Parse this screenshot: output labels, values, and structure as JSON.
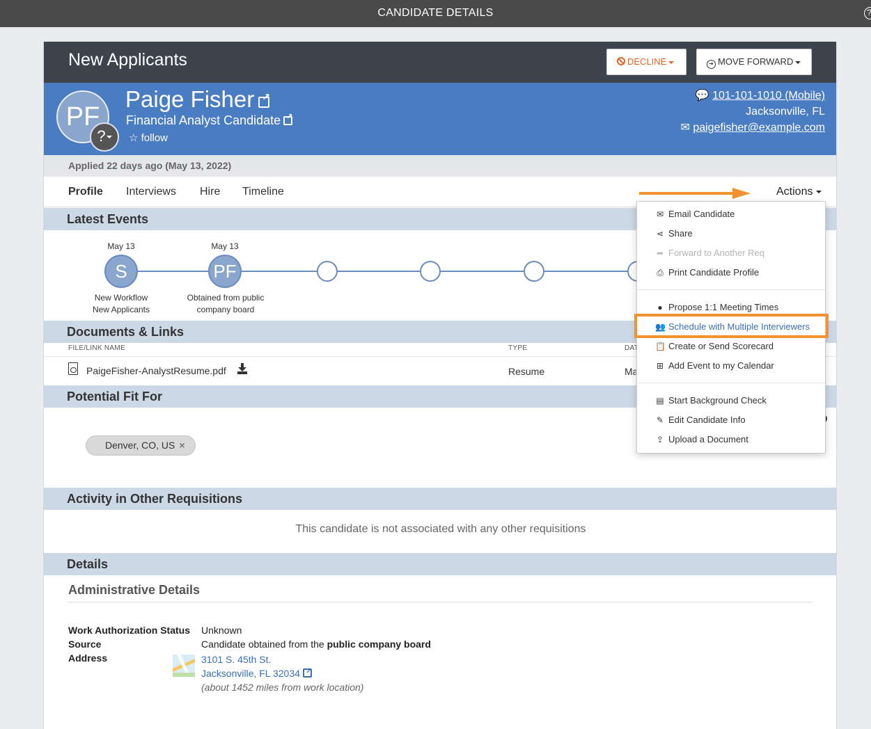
{
  "window": {
    "title": "CANDIDATE DETAILS",
    "help": "?"
  },
  "header": {
    "title": "New Applicants",
    "decline_label": "DECLINE",
    "forward_label": "MOVE FORWARD"
  },
  "candidate": {
    "initials": "PF",
    "name": "Paige Fisher",
    "role": "Financial Analyst Candidate",
    "follow_label": "follow",
    "phone": "101-101-1010 (Mobile)",
    "location": "Jacksonville, FL",
    "email": "paigefisher@example.com",
    "applied": "Applied 22 days ago (May 13, 2022)"
  },
  "tabs": [
    {
      "label": "Profile"
    },
    {
      "label": "Interviews"
    },
    {
      "label": "Hire"
    },
    {
      "label": "Timeline"
    }
  ],
  "actions_label": "Actions",
  "sections": {
    "latest_events": "Latest Events",
    "documents": "Documents & Links",
    "potential_fit": "Potential Fit For",
    "other_reqs": "Activity in Other Requisitions",
    "details": "Details"
  },
  "events": [
    {
      "date": "May 13",
      "initials": "S",
      "label1": "New Workflow",
      "label2": "New Applicants"
    },
    {
      "date": "May 13",
      "initials": "PF",
      "label1": "Obtained from public",
      "label2": "company board"
    }
  ],
  "documents": {
    "headers": {
      "name": "FILE/LINK NAME",
      "type": "TYPE",
      "date": "DAT"
    },
    "rows": [
      {
        "name": "PaigeFisher-AnalystResume.pdf",
        "type": "Resume",
        "date": "Ma"
      }
    ]
  },
  "potential_fit": {
    "chip": "Denver, CO, US",
    "chip_remove": "×"
  },
  "other_reqs_message": "This candidate is not associated with any other requisitions",
  "admin": {
    "title": "Administrative Details",
    "work_auth_label": "Work Authorization Status",
    "work_auth_value": "Unknown",
    "source_label": "Source",
    "source_prefix": "Candidate obtained from the ",
    "source_bold": "public company board",
    "address_label": "Address",
    "address_line1": "3101 S. 45th St.",
    "address_line2": "Jacksonville, FL 32034",
    "address_distance": "(about 1452 miles from work location)"
  },
  "menu": {
    "items": [
      {
        "label": "Email Candidate",
        "icon": "envelope-icon"
      },
      {
        "label": "Share",
        "icon": "share-icon"
      },
      {
        "label": "Forward to Another Req",
        "icon": "forward-icon",
        "disabled": true
      },
      {
        "label": "Print Candidate Profile",
        "icon": "print-icon"
      },
      {
        "label": "Propose 1:1 Meeting Times",
        "icon": "user-icon"
      },
      {
        "label": "Schedule with Multiple Interviewers",
        "icon": "users-icon",
        "highlighted": true
      },
      {
        "label": "Create or Send Scorecard",
        "icon": "clipboard-icon"
      },
      {
        "label": "Add Event to my Calendar",
        "icon": "calendar-plus-icon"
      },
      {
        "label": "Start Background Check",
        "icon": "id-card-icon"
      },
      {
        "label": "Edit Candidate Info",
        "icon": "edit-icon"
      },
      {
        "label": "Upload a Document",
        "icon": "upload-icon"
      }
    ]
  },
  "colors": {
    "accent_blue": "#4a7cc1",
    "header_dark": "#3d444d",
    "decline_orange": "#e0662c",
    "highlight_orange": "#f39330"
  }
}
